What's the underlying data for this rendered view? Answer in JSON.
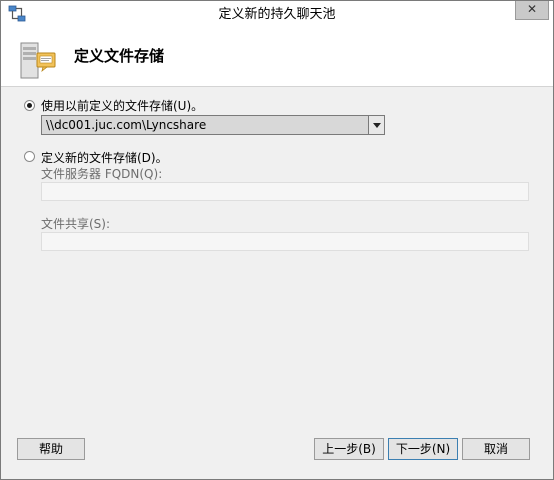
{
  "window": {
    "title": "定义新的持久聊天池",
    "close_label": "✕"
  },
  "header": {
    "title": "定义文件存储"
  },
  "options": {
    "use_existing": {
      "label": "使用以前定义的文件存储(U)。",
      "selected": true,
      "value": "\\\\dc001.juc.com\\Lyncshare"
    },
    "define_new": {
      "label": "定义新的文件存储(D)。",
      "selected": false,
      "fqdn_label": "文件服务器 FQDN(Q):",
      "fqdn_value": "",
      "share_label": "文件共享(S):",
      "share_value": ""
    }
  },
  "buttons": {
    "help": "帮助",
    "back": "上一步(B)",
    "next": "下一步(N)",
    "cancel": "取消"
  }
}
